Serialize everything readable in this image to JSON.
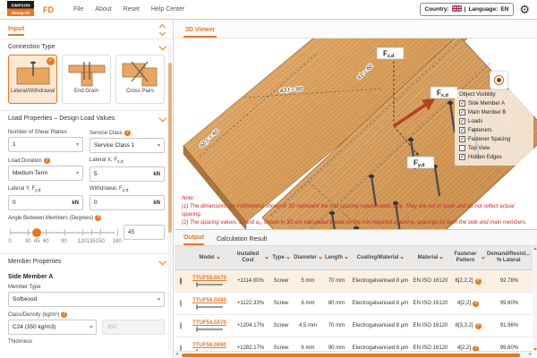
{
  "topbar": {
    "logo_line1": "SIMPSON",
    "logo_line2": "Strong-Tie",
    "app_name": "FD",
    "menu": [
      "File",
      "About",
      "Reset",
      "Help Center"
    ],
    "country_label": "Country:",
    "divider": "|",
    "language_label": "Language:",
    "language_value": "EN"
  },
  "input_panel": {
    "title": "Input",
    "connection_type": {
      "title": "Connection Type",
      "options": [
        {
          "label": "Lateral/Withdrawal",
          "selected": true
        },
        {
          "label": "End Grain",
          "selected": false
        },
        {
          "label": "Cross Pairs",
          "selected": false
        }
      ]
    },
    "load_properties": {
      "title": "Load Properties – Design Load Values",
      "shear_planes": {
        "label": "Number of Shear Planes",
        "value": "1"
      },
      "service_class": {
        "label": "Service Class",
        "value": "Service Class 1"
      },
      "load_duration": {
        "label": "Load Duration",
        "value": "Medium Term"
      },
      "lateral_x": {
        "label": "Lateral X, F",
        "sub": "x,d",
        "value": "5",
        "unit": "kN"
      },
      "lateral_y": {
        "label": "Lateral Y, F",
        "sub": "y,d",
        "value": "0",
        "unit": "kN"
      },
      "withdrawal": {
        "label": "Withdrawal, F",
        "sub": "z,d",
        "value": "0",
        "unit": "kN"
      },
      "angle": {
        "label": "Angle Between Members (Degrees)",
        "value": "45",
        "ticks": [
          "0",
          "30",
          "45",
          "60",
          "90",
          "120",
          "135",
          "150",
          "180"
        ]
      }
    },
    "member_properties": {
      "title": "Member Properties",
      "subtitle": "Side Member A",
      "member_type": {
        "label": "Member Type",
        "value": "Softwood"
      },
      "class_density": {
        "label": "Class/Density (kg/m³)",
        "value": "C24 (350 kg/m3)",
        "density": "350"
      },
      "thickness_label": "Thickness"
    }
  },
  "viewer": {
    "tab": "3D Viewer",
    "forces": {
      "fx_main": "F",
      "fx_sub": "x,d",
      "fy_main": "F",
      "fy_sub": "y,d",
      "fz_main": "F",
      "fz_sub": "z,d"
    },
    "dimensions": {
      "a3t": "a3,t = 80",
      "a1": "a1 = 60",
      "a3c": "a3,c = 60"
    },
    "object_visibility": {
      "title": "Object Visibility",
      "items": [
        {
          "label": "Side Member A",
          "checked": true
        },
        {
          "label": "Main Member B",
          "checked": true
        },
        {
          "label": "Loads",
          "checked": true
        },
        {
          "label": "Fasteners",
          "checked": true
        },
        {
          "label": "Fastener Spacing",
          "checked": true
        },
        {
          "label": "Top View",
          "checked": false
        },
        {
          "label": "Hidden Edges",
          "checked": true
        }
      ]
    },
    "note": {
      "title": "Note:",
      "line1": "(1) The dimensions (in millimeters) shown in 3D represent the min spacing requirements only. They are not to scale and do not reflect actual spacing.",
      "line2": "(2) The spacing values, a₁ and a₂, shown in 3D are calculated based on the min required a₁ and a₂ spacings for both the side and main members."
    }
  },
  "output": {
    "tabs": [
      {
        "label": "Output",
        "active": true
      },
      {
        "label": "Calculation Result",
        "active": false
      }
    ],
    "columns": {
      "model": "Model",
      "cost": "Installed Cost",
      "type": "Type",
      "diameter": "Diameter",
      "length": "Length",
      "coating": "Coating/Material",
      "material": "Material",
      "pattern": "Fastener Pattern",
      "demand": "Demand/Resist... % Lateral"
    },
    "rows": [
      {
        "model": "TTUF55.0X70",
        "cost": "+1114.00%",
        "type": "Screw",
        "diameter": "5 mm",
        "length": "70 mm",
        "coating": "Electrogalvanised 8 μm",
        "material": "EN ISO 16120",
        "pattern": "6[2,2,2]",
        "demand": "92.78%",
        "selected": true
      },
      {
        "model": "TTUF56.0X80",
        "cost": "+1122.33%",
        "type": "Screw",
        "diameter": "6 mm",
        "length": "80 mm",
        "coating": "Electrogalvanised 8 μm",
        "material": "EN ISO 16120",
        "pattern": "4[2,2]",
        "demand": "99.60%",
        "selected": false
      },
      {
        "model": "TTUF54.5X70",
        "cost": "+1204.17%",
        "type": "Screw",
        "diameter": "4.5 mm",
        "length": "70 mm",
        "coating": "Electrogalvanised 8 μm",
        "material": "EN ISO 16120",
        "pattern": "8[3,3,2]",
        "demand": "91.96%",
        "selected": false
      },
      {
        "model": "TTUF56.0X90",
        "cost": "+1282.17%",
        "type": "Screw",
        "diameter": "6 mm",
        "length": "90 mm",
        "coating": "Electrogalvanised 8 μm",
        "material": "EN ISO 16120",
        "pattern": "4[2,2]",
        "demand": "99.60%",
        "selected": false
      }
    ]
  },
  "colors": {
    "accent": "#E87722",
    "note_red": "#C62828",
    "wood_light": "#E6B273",
    "wood_dark": "#C4874A"
  }
}
